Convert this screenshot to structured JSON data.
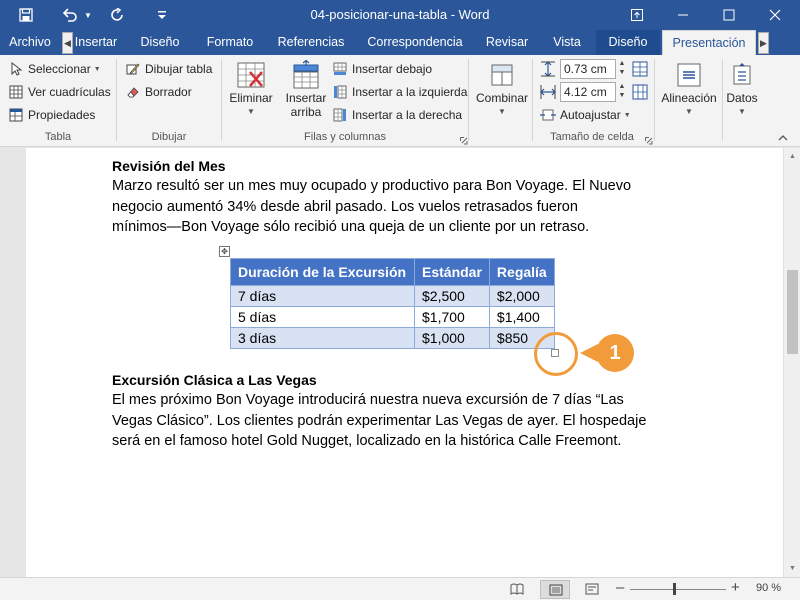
{
  "window": {
    "title": "04-posicionar-una-tabla - Word"
  },
  "tabs": [
    {
      "label": "Archivo"
    },
    {
      "label": "Insertar"
    },
    {
      "label": "Diseño"
    },
    {
      "label": "Formato"
    },
    {
      "label": "Referencias"
    },
    {
      "label": "Correspondencia"
    },
    {
      "label": "Revisar"
    },
    {
      "label": "Vista"
    },
    {
      "label": "Diseño"
    },
    {
      "label": "Presentación"
    }
  ],
  "ribbon": {
    "tabla": {
      "label": "Tabla",
      "seleccionar": "Seleccionar",
      "ver_cuadriculas": "Ver cuadrículas",
      "propiedades": "Propiedades"
    },
    "dibujar": {
      "label": "Dibujar",
      "dibujar_tabla": "Dibujar tabla",
      "borrador": "Borrador"
    },
    "filas": {
      "label": "Filas y columnas",
      "eliminar": "Eliminar",
      "insertar_arriba_1": "Insertar",
      "insertar_arriba_2": "arriba",
      "insertar_debajo": "Insertar debajo",
      "insertar_izquierda": "Insertar a la izquierda",
      "insertar_derecha": "Insertar a la derecha"
    },
    "combinar": {
      "label": "Combinar"
    },
    "tamano": {
      "label": "Tamaño de celda",
      "alto": "0.73 cm",
      "ancho": "4.12 cm",
      "autoajustar": "Autoajustar"
    },
    "alineacion": {
      "label": "Alineación"
    },
    "datos": {
      "label": "Datos"
    }
  },
  "document": {
    "section1": {
      "heading": "Revisión del Mes",
      "lines": [
        "Marzo resultó ser un mes muy ocupado y productivo para Bon Voyage. El Nuevo",
        "negocio aumentó 34% desde abril pasado. Los vuelos retrasados fueron",
        "mínimos—Bon Voyage sólo recibió una queja de un cliente por un retraso."
      ]
    },
    "table": {
      "headers": [
        "Duración de la Excursión",
        "Estándar",
        "Regalía"
      ],
      "rows": [
        [
          "7 días",
          "$2,500",
          "$2,000"
        ],
        [
          "5 días",
          "$1,700",
          "$1,400"
        ],
        [
          "3 días",
          "$1,000",
          "$850"
        ]
      ]
    },
    "section2": {
      "heading": "Excursión Clásica a Las Vegas",
      "lines": [
        "El mes próximo Bon Voyage introducirá nuestra nueva excursión de 7 días “Las",
        "Vegas Clásico”. Los clientes podrán experimentar Las Vegas de ayer. El hospedaje",
        "será en el famoso hotel Gold Nugget, localizado en la histórica Calle Freemont."
      ]
    },
    "callout": "1"
  },
  "status": {
    "zoom": "90 %"
  },
  "colors": {
    "brand": "#2b579a",
    "table_header": "#4472c4",
    "table_band": "#d9e2f3",
    "callout": "#f29b3a"
  }
}
